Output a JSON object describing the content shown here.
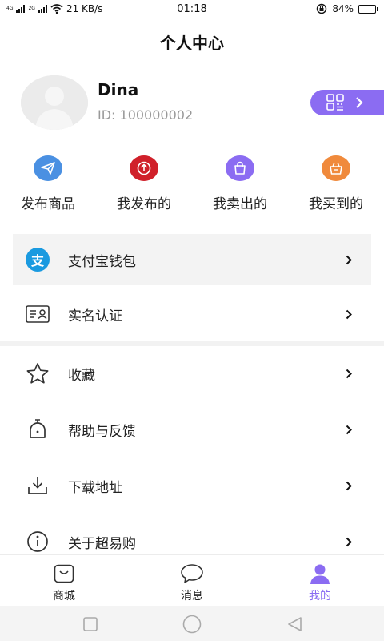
{
  "status_bar": {
    "network_type": "4G",
    "network_type_2": "2G",
    "speed": "21 KB/s",
    "time": "01:18",
    "battery_percent": "84%",
    "battery_level": 0.84
  },
  "header": {
    "title": "个人中心"
  },
  "profile": {
    "name": "Dina",
    "id_text": "ID: 100000002"
  },
  "actions": [
    {
      "label": "发布商品",
      "icon": "paper-plane-icon",
      "color": "#4a90e2"
    },
    {
      "label": "我发布的",
      "icon": "upload-icon",
      "color": "#d0202a"
    },
    {
      "label": "我卖出的",
      "icon": "shopping-bag-icon",
      "color": "#8b6cf2"
    },
    {
      "label": "我买到的",
      "icon": "basket-icon",
      "color": "#f08a3c"
    }
  ],
  "menu": [
    {
      "label": "支付宝钱包",
      "icon": "alipay-icon",
      "glyph": "支"
    },
    {
      "label": "实名认证",
      "icon": "id-card-icon"
    },
    {
      "label": "收藏",
      "icon": "star-icon"
    },
    {
      "label": "帮助与反馈",
      "icon": "bell-icon"
    },
    {
      "label": "下载地址",
      "icon": "download-icon"
    },
    {
      "label": "关于超易购",
      "icon": "info-icon"
    }
  ],
  "bottom_nav": [
    {
      "label": "商城",
      "icon": "shop-icon"
    },
    {
      "label": "消息",
      "icon": "chat-bubble-icon"
    },
    {
      "label": "我的",
      "icon": "person-icon",
      "active": true
    }
  ],
  "colors": {
    "accent": "#8b6cf2",
    "alipay": "#1a9ae0"
  }
}
